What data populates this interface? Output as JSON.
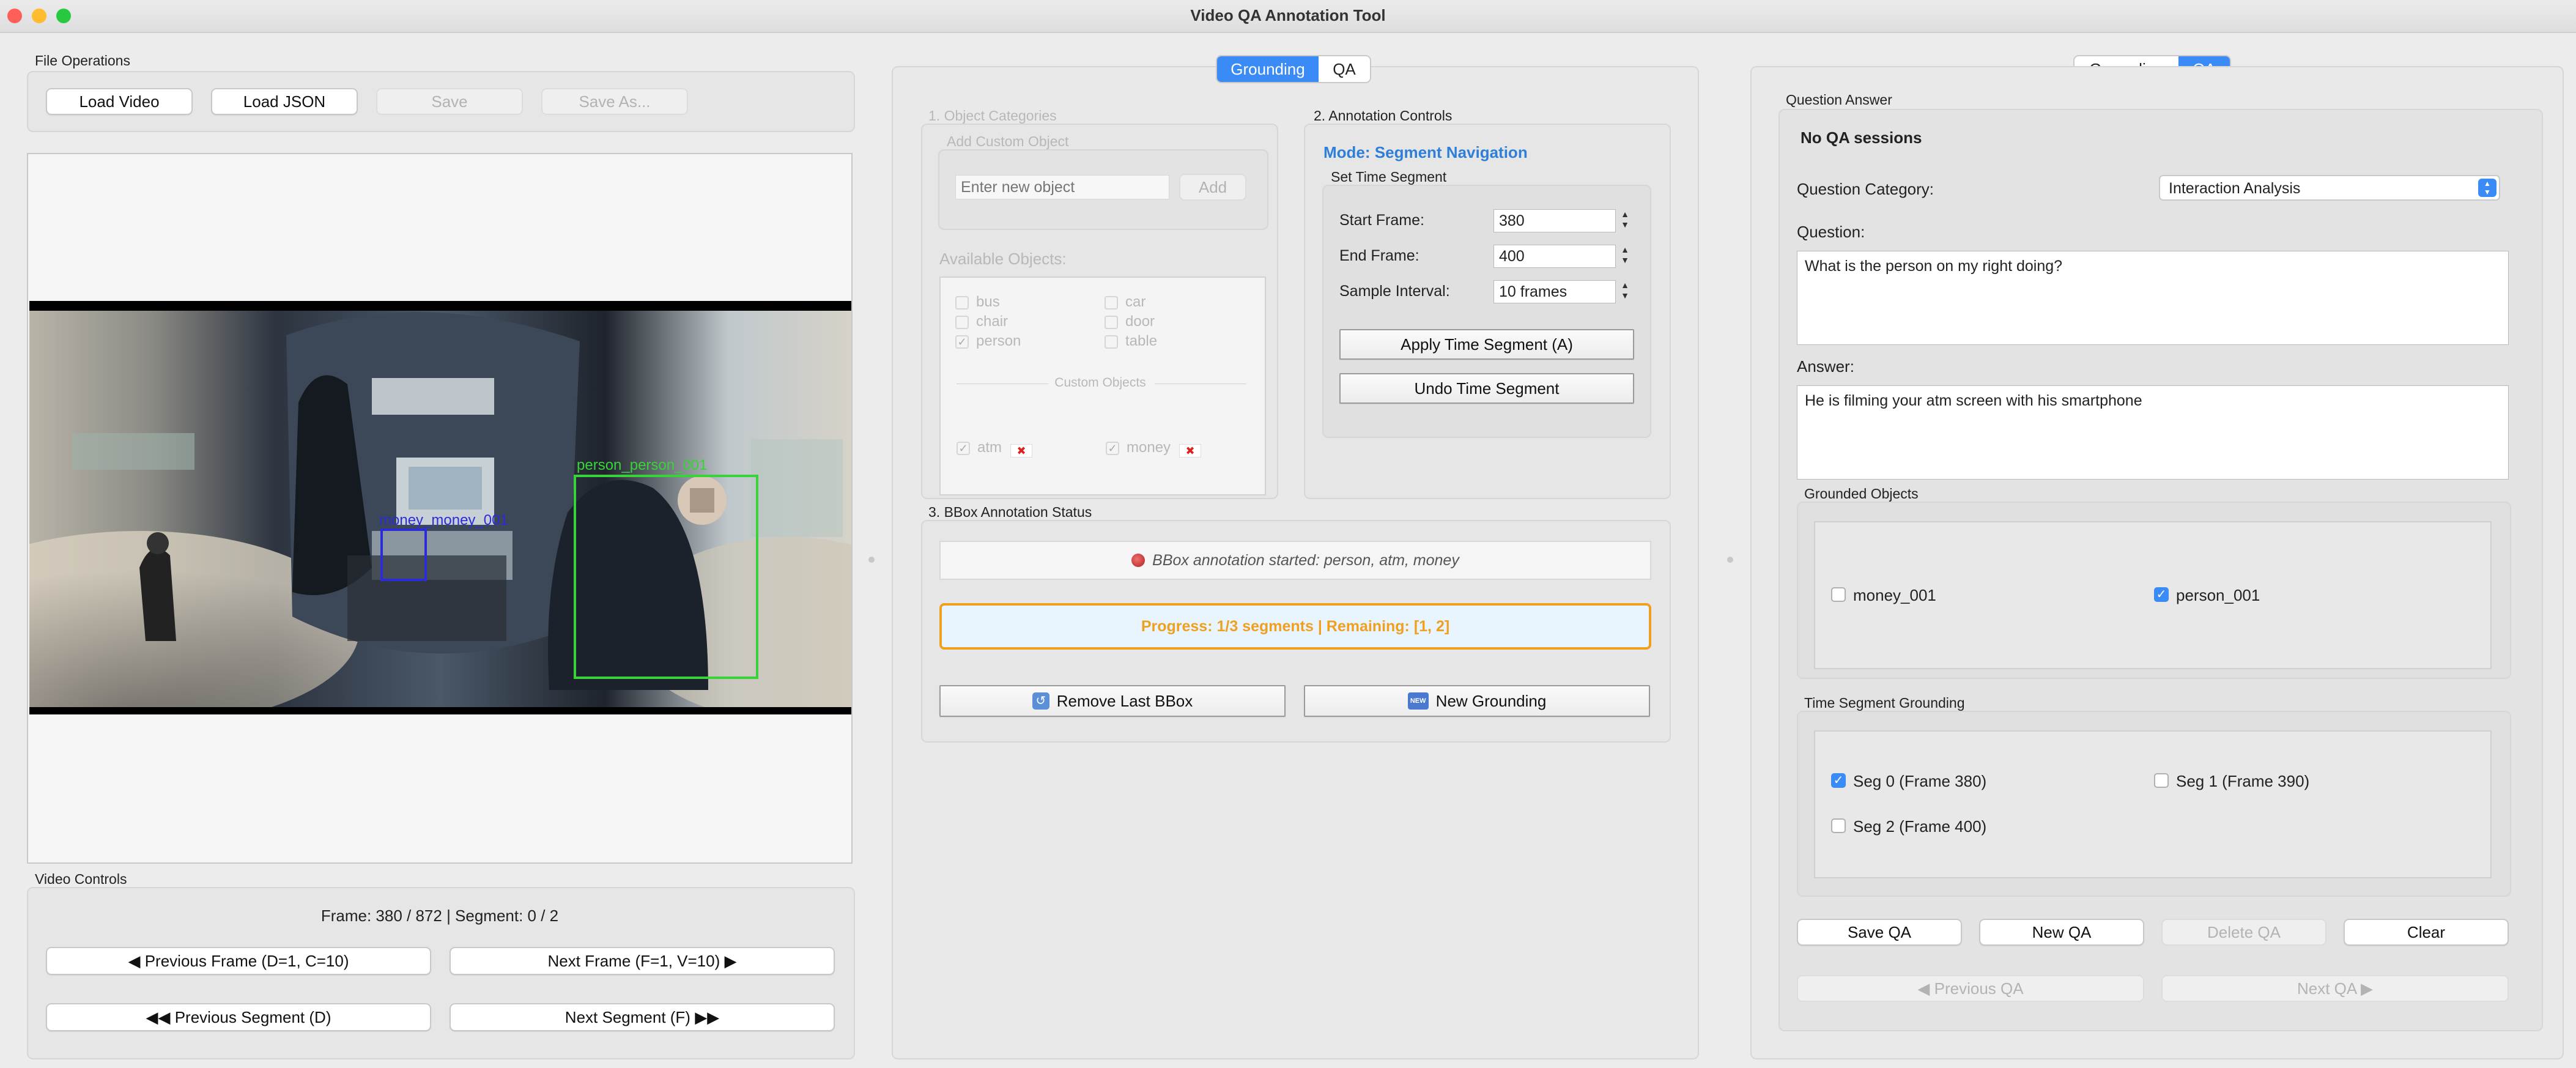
{
  "window": {
    "title": "Video QA Annotation Tool"
  },
  "left": {
    "file_ops_label": "File Operations",
    "buttons": {
      "load_video": "Load Video",
      "load_json": "Load JSON",
      "save": "Save",
      "save_as": "Save As..."
    },
    "bbox_labels": {
      "person": "person_person_001",
      "money": "money_money_001"
    },
    "video_controls_label": "Video Controls",
    "frame_info": "Frame: 380 / 872 | Segment: 0 / 2",
    "nav": {
      "prev_frame": "◀ Previous Frame (D=1, C=10)",
      "next_frame": "Next Frame (F=1, V=10) ▶",
      "prev_segment": "◀◀ Previous Segment (D)",
      "next_segment": "Next Segment (F) ▶▶"
    }
  },
  "middle": {
    "tabs": [
      "Grounding",
      "QA"
    ],
    "object_categories": {
      "label": "1. Object Categories",
      "add_custom_label": "Add Custom Object",
      "input_placeholder": "Enter new object",
      "add_button": "Add",
      "available_label": "Available Objects:",
      "objects": [
        {
          "name": "bus",
          "checked": false
        },
        {
          "name": "car",
          "checked": false
        },
        {
          "name": "chair",
          "checked": false
        },
        {
          "name": "door",
          "checked": false
        },
        {
          "name": "person",
          "checked": true
        },
        {
          "name": "table",
          "checked": false
        }
      ],
      "custom_label": "Custom Objects",
      "custom_objects": [
        {
          "name": "atm",
          "checked": true
        },
        {
          "name": "money",
          "checked": true
        }
      ]
    },
    "annotation_controls": {
      "label": "2. Annotation Controls",
      "mode": "Mode: Segment Navigation",
      "set_time_label": "Set Time Segment",
      "start_frame_label": "Start Frame:",
      "start_frame": "380",
      "end_frame_label": "End Frame:",
      "end_frame": "400",
      "sample_interval_label": "Sample Interval:",
      "sample_interval": "10 frames",
      "apply_button": "Apply Time Segment (A)",
      "undo_button": "Undo Time Segment"
    },
    "bbox_status": {
      "label": "3. BBox Annotation Status",
      "status_text": "BBox annotation started: person, atm, money",
      "progress_text": "Progress: 1/3 segments | Remaining: [1, 2]",
      "remove_button": "Remove Last BBox",
      "new_grounding_button": "New Grounding",
      "new_badge": "NEW"
    }
  },
  "right": {
    "tabs": [
      "Grounding",
      "QA"
    ],
    "section_label": "Question  Answer",
    "sessions": "No QA sessions",
    "category_label": "Question Category:",
    "category_value": "Interaction Analysis",
    "question_label": "Question:",
    "question": "What is the person on my right doing?",
    "answer_label": "Answer:",
    "answer": "He is filming your atm screen with his smartphone",
    "grounded_label": "Grounded Objects",
    "grounded_objects": [
      {
        "name": "money_001",
        "checked": false
      },
      {
        "name": "person_001",
        "checked": true
      }
    ],
    "time_grounding_label": "Time Segment Grounding",
    "segments": [
      {
        "name": "Seg 0 (Frame 380)",
        "checked": true
      },
      {
        "name": "Seg 1 (Frame 390)",
        "checked": false
      },
      {
        "name": "Seg 2 (Frame 400)",
        "checked": false
      }
    ],
    "buttons": {
      "save_qa": "Save QA",
      "new_qa": "New QA",
      "delete_qa": "Delete QA",
      "clear": "Clear",
      "prev_qa": "◀ Previous QA",
      "next_qa": "Next QA ▶"
    }
  },
  "colors": {
    "accent": "#3b8bf6",
    "progress": "#f0a020",
    "person_box": "#3ad23a",
    "money_box": "#2b2bd8"
  }
}
